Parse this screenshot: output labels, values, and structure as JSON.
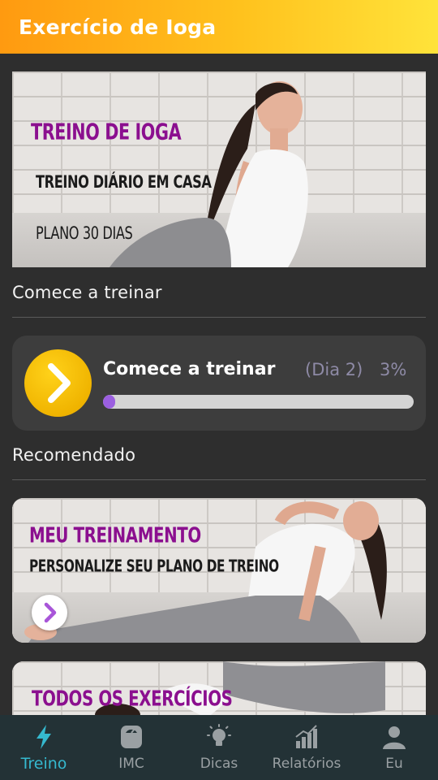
{
  "app": {
    "title": "Exercício de Ioga"
  },
  "hero_banner": {
    "line1": "TREINO DE IOGA",
    "line2": "TREINO DIÁRIO EM CASA",
    "line3": "PLANO 30 DIAS"
  },
  "start_section": {
    "title": "Comece a treinar"
  },
  "progress_card": {
    "title": "Comece a treinar",
    "day": "(Dia 2)",
    "percent_label": "3%",
    "progress_fraction": 0.03,
    "button_color": "#f5c000",
    "bar_color": "#9b5fe0"
  },
  "recommended_section": {
    "title": "Recomendado"
  },
  "recommended": [
    {
      "title": "MEU TREINAMENTO",
      "subtitle": "PERSONALIZE SEU PLANO DE TREINO"
    },
    {
      "title": "TODOS OS EXERCÍCIOS"
    }
  ],
  "bottom_nav": {
    "active_color": "#35b9cf",
    "items": [
      {
        "label": "Treino",
        "icon": "lightning-icon",
        "active": true
      },
      {
        "label": "IMC",
        "icon": "scale-icon",
        "active": false
      },
      {
        "label": "Dicas",
        "icon": "lightbulb-icon",
        "active": false
      },
      {
        "label": "Relatórios",
        "icon": "bar-chart-icon",
        "active": false
      },
      {
        "label": "Eu",
        "icon": "person-icon",
        "active": false
      }
    ]
  }
}
